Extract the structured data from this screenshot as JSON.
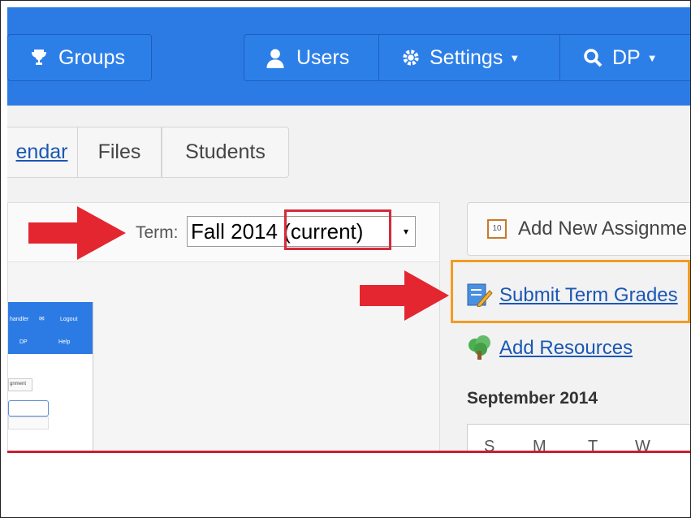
{
  "nav": {
    "groups_label": "Groups",
    "users_label": "Users",
    "settings_label": "Settings",
    "search_label": "DP"
  },
  "tabs": {
    "calendar_label": "endar",
    "files_label": "Files",
    "students_label": "Students"
  },
  "term": {
    "label": "Term:",
    "selected_value": "Fall 2014 (current)"
  },
  "actions": {
    "add_assignment_label": "Add New Assignme",
    "submit_grades_label": "Submit Term Grades",
    "add_resources_label": "Add Resources"
  },
  "calendar": {
    "title": "September 2014",
    "day_headers": [
      "S",
      "M",
      "T",
      "W"
    ]
  },
  "mini": {
    "user_label": "handler",
    "logout_label": "Logout",
    "dp_label": "DP",
    "help_label": "Help",
    "assignment_label": "gnment"
  },
  "colors": {
    "topbar": "#2c7be5",
    "arrow": "#e3262f",
    "highlight_red": "#d42b3a",
    "highlight_orange": "#f29b25",
    "link": "#1a57b5"
  }
}
